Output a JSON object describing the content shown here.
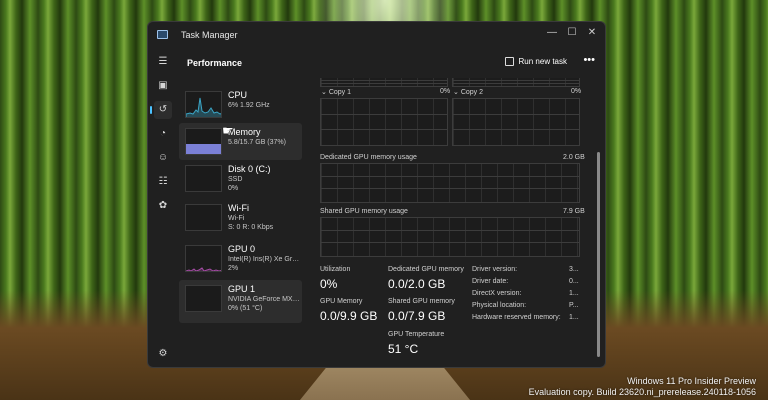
{
  "window": {
    "title": "Task Manager",
    "controls": {
      "minimize": "—",
      "maximize": "☐",
      "close": "✕"
    }
  },
  "nav": {
    "items": [
      {
        "icon": "hamburger-icon",
        "glyph": "☰"
      },
      {
        "icon": "performance-icon",
        "glyph": "▣",
        "active": true
      },
      {
        "icon": "app-history-icon",
        "glyph": "↺"
      },
      {
        "icon": "startup-apps-icon",
        "glyph": "◔"
      },
      {
        "icon": "users-icon",
        "glyph": "☺"
      },
      {
        "icon": "details-icon",
        "glyph": "☷"
      },
      {
        "icon": "services-icon",
        "glyph": "✿"
      },
      {
        "icon": "settings-icon",
        "glyph": "⚙"
      }
    ]
  },
  "header": {
    "title": "Performance",
    "run_task": "Run new task",
    "more": "•••"
  },
  "devices": [
    {
      "name": "CPU",
      "line2": "6% 1.92 GHz",
      "line3": ""
    },
    {
      "name": "Memory",
      "line2": "5.8/15.7 GB (37%)",
      "line3": "",
      "selected": true
    },
    {
      "name": "Disk 0 (C:)",
      "line2": "SSD",
      "line3": "0%"
    },
    {
      "name": "Wi-Fi",
      "line2": "Wi-Fi",
      "line3": "S: 0 R: 0 Kbps"
    },
    {
      "name": "GPU 0",
      "line2": "Intel(R) Iris(R) Xe Grap...",
      "line3": "2%"
    },
    {
      "name": "GPU 1",
      "line2": "NVIDIA GeForce MX4...",
      "line3": "0% (51 °C)"
    }
  ],
  "gpu": {
    "engines": [
      {
        "label": "Copy 1",
        "percent": "0%"
      },
      {
        "label": "Copy 2",
        "percent": "0%"
      }
    ],
    "dedicated": {
      "label": "Dedicated GPU memory usage",
      "max": "2.0 GB"
    },
    "shared": {
      "label": "Shared GPU memory usage",
      "max": "7.9 GB"
    },
    "stats": {
      "utilization": {
        "label": "Utilization",
        "value": "0%"
      },
      "dedicated_memory": {
        "label": "Dedicated GPU memory",
        "value": "0.0/2.0 GB"
      },
      "gpu_memory": {
        "label": "GPU Memory",
        "value": "0.0/9.9 GB"
      },
      "shared_memory": {
        "label": "Shared GPU memory",
        "value": "0.0/7.9 GB"
      },
      "temperature": {
        "label": "GPU Temperature",
        "value": "51 °C"
      }
    },
    "info": [
      {
        "key": "Driver version:",
        "value": "3..."
      },
      {
        "key": "Driver date:",
        "value": "0..."
      },
      {
        "key": "DirectX version:",
        "value": "1..."
      },
      {
        "key": "Physical location:",
        "value": "P..."
      },
      {
        "key": "Hardware reserved memory:",
        "value": "1..."
      }
    ]
  },
  "watermark": {
    "line1": "Windows 11 Pro Insider Preview",
    "line2": "Evaluation copy. Build 23620.ni_prerelease.240118-1056"
  },
  "colors": {
    "accent": "#4cc2ff",
    "cpu_graph": "#3ba6c7",
    "memory_graph": "#8a8ee0",
    "gpu_graph": "#a64ca6"
  }
}
